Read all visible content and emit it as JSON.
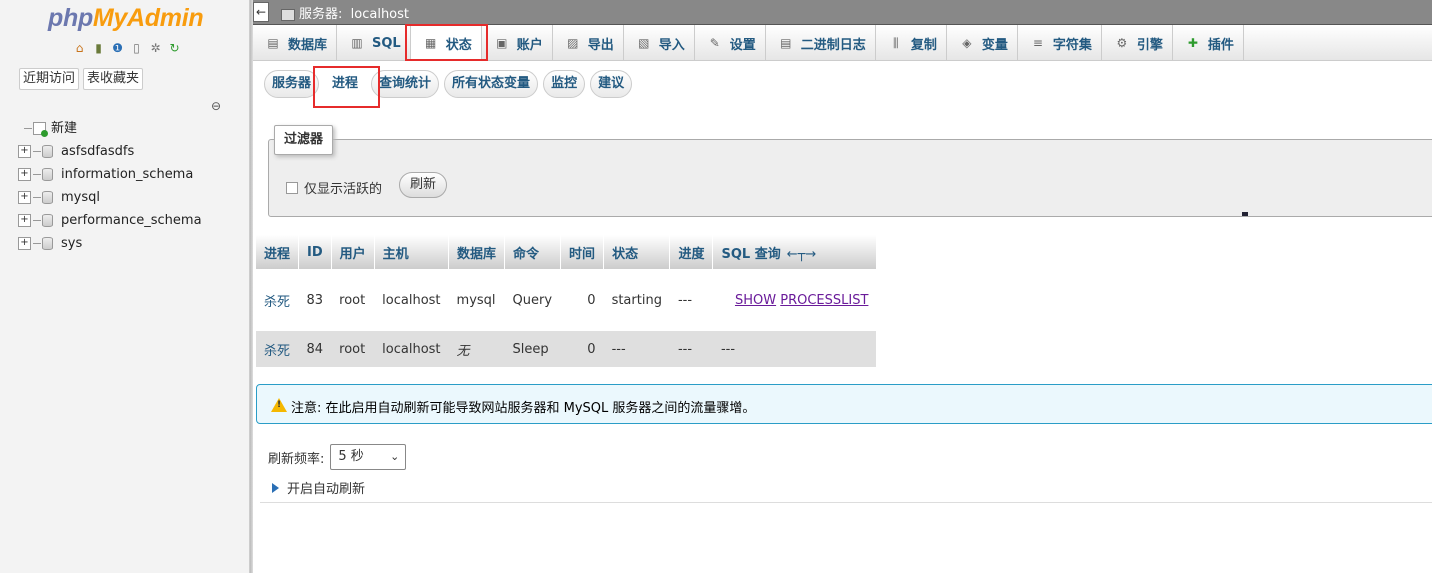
{
  "sidebar": {
    "logo_php": "php",
    "logo_myadmin": "MyAdmin",
    "icons": [
      "home-icon",
      "logout-icon",
      "help-icon",
      "docs-icon",
      "settings-icon",
      "reload-icon"
    ],
    "recent_label": "近期访问",
    "favorites_label": "表收藏夹",
    "new_label": "新建",
    "databases": [
      "asfsdfasdfs",
      "information_schema",
      "mysql",
      "performance_schema",
      "sys"
    ]
  },
  "topbar": {
    "back": "←",
    "server_prefix": "服务器:",
    "server_name": "localhost"
  },
  "tabs": [
    {
      "label": "数据库",
      "icon": "database-icon",
      "glyph": "▤"
    },
    {
      "label": "SQL",
      "icon": "sql-icon",
      "glyph": "▥"
    },
    {
      "label": "状态",
      "icon": "status-icon",
      "glyph": "▦"
    },
    {
      "label": "账户",
      "icon": "accounts-icon",
      "glyph": "▣"
    },
    {
      "label": "导出",
      "icon": "export-icon",
      "glyph": "▨"
    },
    {
      "label": "导入",
      "icon": "import-icon",
      "glyph": "▧"
    },
    {
      "label": "设置",
      "icon": "settings-icon",
      "glyph": "✎"
    },
    {
      "label": "二进制日志",
      "icon": "binlog-icon",
      "glyph": "▤"
    },
    {
      "label": "复制",
      "icon": "replication-icon",
      "glyph": "⫼"
    },
    {
      "label": "变量",
      "icon": "variables-icon",
      "glyph": "◈"
    },
    {
      "label": "字符集",
      "icon": "charset-icon",
      "glyph": "≡"
    },
    {
      "label": "引擎",
      "icon": "engine-icon",
      "glyph": "⚙"
    },
    {
      "label": "插件",
      "icon": "plugin-icon",
      "glyph": "✚"
    }
  ],
  "subtabs": [
    "服务器",
    "进程",
    "查询统计",
    "所有状态变量",
    "监控",
    "建议"
  ],
  "filter": {
    "legend": "过滤器",
    "checkbox_label": "仅显示活跃的",
    "refresh_button": "刷新"
  },
  "table": {
    "headers": [
      "进程",
      "ID",
      "用户",
      "主机",
      "数据库",
      "命令",
      "时间",
      "状态",
      "进度",
      "SQL 查询"
    ],
    "header_arrows": "←┬→",
    "rows": [
      {
        "kill": "杀死",
        "id": "83",
        "user": "root",
        "host": "localhost",
        "db": "mysql",
        "command": "Query",
        "time": "0",
        "state": "starting",
        "progress": "---",
        "sql_a": "SHOW",
        "sql_b": "PROCESSLIST"
      },
      {
        "kill": "杀死",
        "id": "84",
        "user": "root",
        "host": "localhost",
        "db": "无",
        "command": "Sleep",
        "time": "0",
        "state": "---",
        "progress": "---",
        "sql_a": "---",
        "sql_b": ""
      }
    ]
  },
  "notice": {
    "text": "注意: 在此启用自动刷新可能导致网站服务器和 MySQL 服务器之间的流量骤增。"
  },
  "refresh_rate": {
    "label": "刷新频率:",
    "value": "5 秒"
  },
  "auto_refresh": {
    "label": "开启自动刷新"
  }
}
